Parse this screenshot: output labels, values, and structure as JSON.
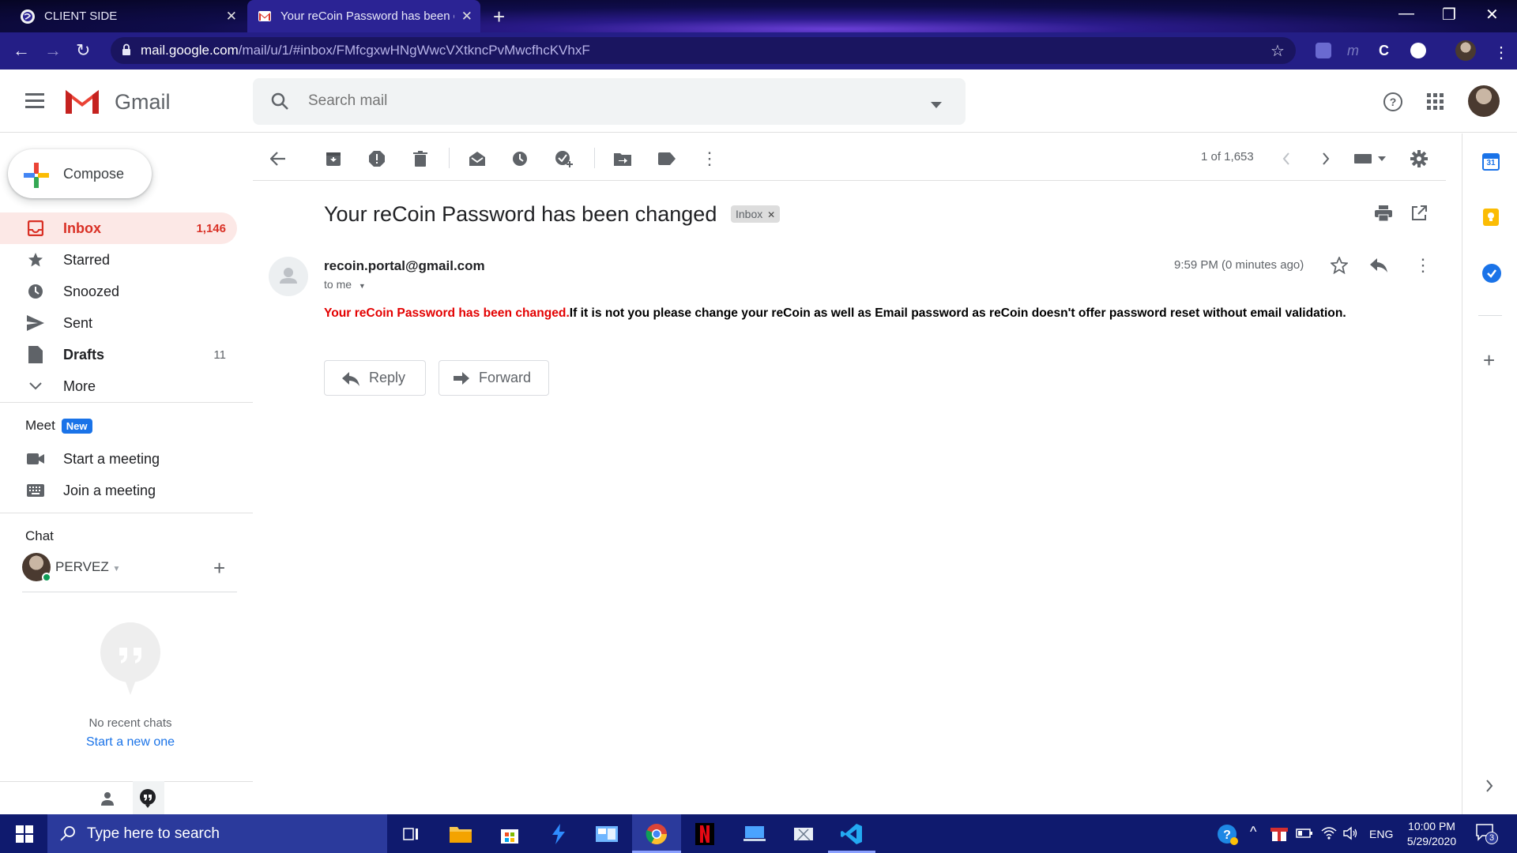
{
  "browser": {
    "tabs": [
      {
        "title": "CLIENT SIDE"
      },
      {
        "title": "Your reCoin Password has been c"
      }
    ],
    "url_host": "mail.google.com",
    "url_path": "/mail/u/1/#inbox/FMfcgxwHNgWwcVXtkncPvMwcfhcKVhxF"
  },
  "gmail": {
    "brand": "Gmail",
    "search_placeholder": "Search mail",
    "compose_label": "Compose",
    "nav": [
      {
        "label": "Inbox",
        "count": "1,146"
      },
      {
        "label": "Starred",
        "count": ""
      },
      {
        "label": "Snoozed",
        "count": ""
      },
      {
        "label": "Sent",
        "count": ""
      },
      {
        "label": "Drafts",
        "count": "11"
      },
      {
        "label": "More",
        "count": ""
      }
    ],
    "meet": {
      "title": "Meet",
      "badge": "New",
      "start": "Start a meeting",
      "join": "Join a meeting"
    },
    "chat": {
      "title": "Chat",
      "user": "PERVEZ",
      "empty": "No recent chats",
      "start_new": "Start a new one"
    },
    "pagination": "1 of 1,653",
    "message": {
      "subject": "Your reCoin Password has been changed",
      "label_chip": "Inbox",
      "sender": "recoin.portal@gmail.com",
      "to": "to me",
      "time": "9:59 PM (0 minutes ago)",
      "body_red": "Your reCoin Password has been changed.",
      "body_rest": "If it is not you please change your reCoin as well as Email password as reCoin doesn't offer password reset without email validation.",
      "reply_label": "Reply",
      "forward_label": "Forward"
    }
  },
  "taskbar": {
    "search_placeholder": "Type here to search",
    "language": "ENG",
    "time": "10:00 PM",
    "date": "5/29/2020",
    "notification_count": "3"
  },
  "colors": {
    "inbox_red": "#d93025",
    "body_red": "#e30000",
    "taskbar": "#0f1a6e",
    "chrome_toolbar": "#241e86"
  }
}
